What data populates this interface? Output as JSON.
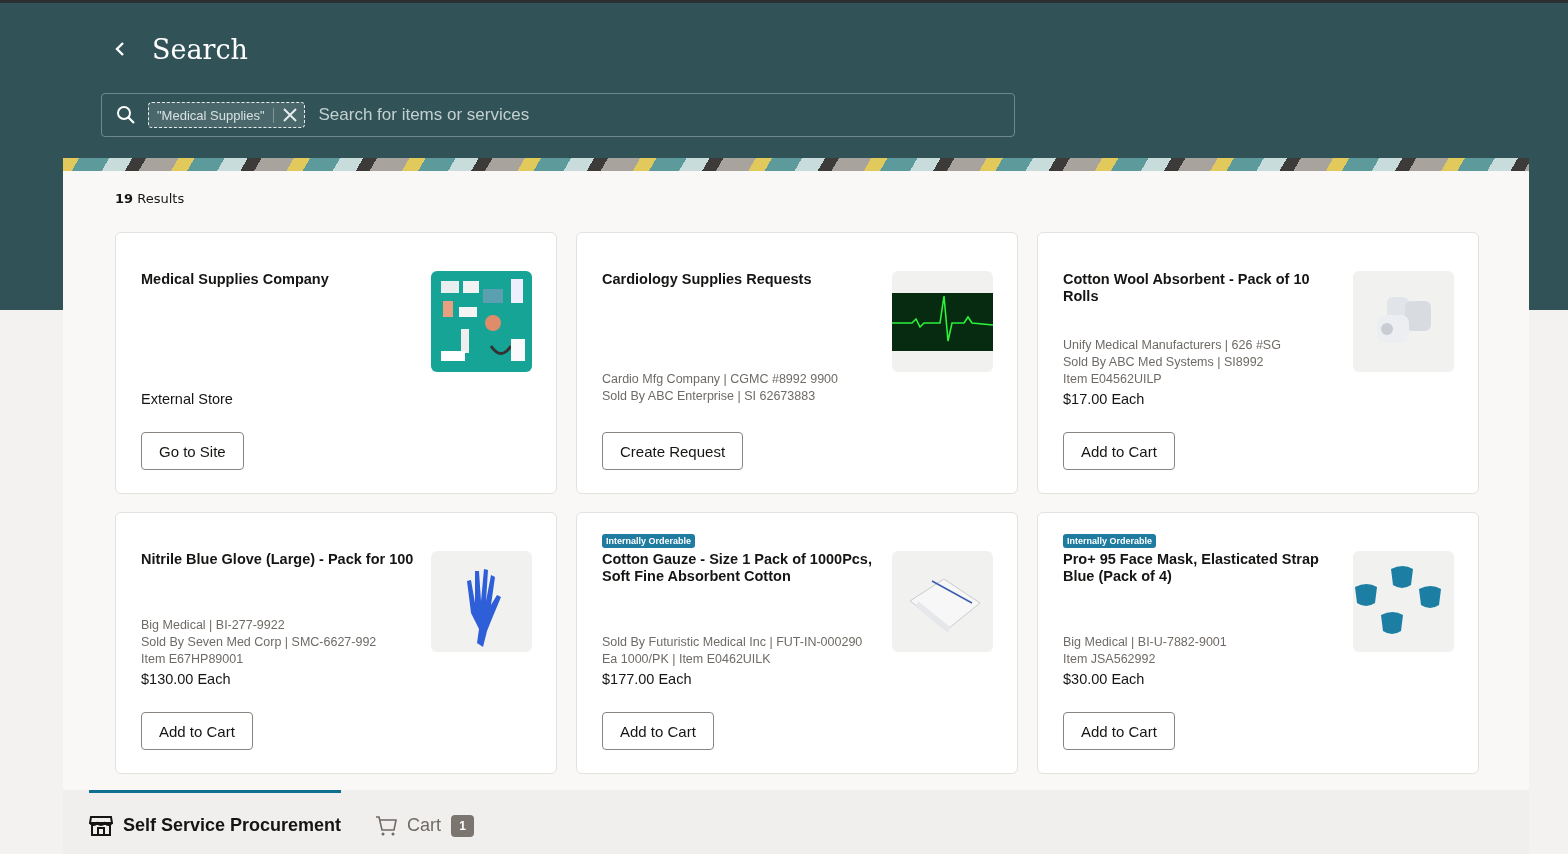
{
  "header": {
    "title": "Search"
  },
  "search": {
    "chip": "\"Medical Supplies\"",
    "placeholder": "Search for items or services"
  },
  "results_count": {
    "number": "19",
    "label": "Results"
  },
  "cards": [
    {
      "kind": "store",
      "title": "Medical Supplies Company",
      "price": "External Store",
      "button": "Go to Site"
    },
    {
      "kind": "request",
      "title": "Cardiology Supplies Requests",
      "details": [
        "Cardio Mfg Company | CGMC #8992 9900",
        "Sold By ABC Enterprise | SI 62673883"
      ],
      "button": "Create Request"
    },
    {
      "kind": "item",
      "title": "Cotton Wool Absorbent - Pack of 10 Rolls",
      "details": [
        "Unify Medical Manufacturers | 626 #SG",
        "Sold By ABC Med Systems | SI8992",
        "Item E04562UILP"
      ],
      "price": "$17.00 Each",
      "button": "Add to Cart"
    },
    {
      "kind": "item",
      "title": "Nitrile Blue Glove (Large) - Pack for 100",
      "details": [
        "Big Medical | BI-277-9922",
        "Sold By Seven Med Corp | SMC-6627-992",
        "Item E67HP89001"
      ],
      "price": "$130.00 Each",
      "button": "Add to Cart"
    },
    {
      "kind": "item",
      "badge": "Internally Orderable",
      "title": "Cotton Gauze - Size 1 Pack of 1000Pcs, Soft Fine Absorbent Cotton",
      "details": [
        "Sold By Futuristic Medical Inc | FUT-IN-000290",
        "Ea 1000/PK | Item E0462UILK"
      ],
      "price": "$177.00 Each",
      "button": "Add to Cart"
    },
    {
      "kind": "item",
      "badge": "Internally Orderable",
      "title": "Pro+ 95 Face Mask, Elasticated Strap Blue (Pack of 4)",
      "details": [
        "Big Medical | BI-U-7882-9001",
        "Item JSA562992"
      ],
      "price": "$30.00 Each",
      "button": "Add to Cart"
    }
  ],
  "bottom_tabs": [
    {
      "kind": "store",
      "label": "Self Service Procurement",
      "selected": true
    },
    {
      "kind": "cart",
      "label": "Cart",
      "selected": false,
      "count": "1"
    }
  ]
}
